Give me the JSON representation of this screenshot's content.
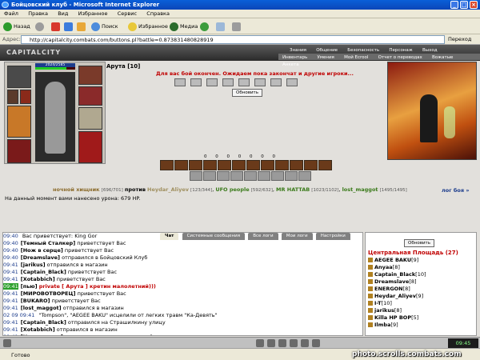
{
  "window": {
    "title": "Бойцовский клуб - Microsoft Internet Explorer"
  },
  "menu": [
    "Файл",
    "Правка",
    "Вид",
    "Избранное",
    "Сервис",
    "Справка"
  ],
  "toolbar": {
    "back": "Назад",
    "search": "Поиск",
    "favorites": "Избранное",
    "media": "Медиа"
  },
  "address": {
    "label": "Адрес:",
    "url": "http://capitalcity.combats.com/buttons.pl?battle=0.873831480828919",
    "go": "Переход"
  },
  "site": {
    "logo": "CAPITALCITY",
    "nav_top": [
      "Знания",
      "Общение",
      "Безопасность",
      "Персонаж",
      "Выход"
    ],
    "nav_sub": [
      "Инвентарь",
      "Умения",
      "Мой Ecrool",
      "Отчет о переводах",
      "Вожатые",
      "Анкета"
    ]
  },
  "character": {
    "name": "Арута [10]",
    "hp_text": "2024/2585",
    "hp_fraction": 0.78,
    "level_tag": "A 7627"
  },
  "battle": {
    "message": "Для вас бой окончен. Ожидаем пока закончат и другие игроки...",
    "refresh_label": "Обновить",
    "counts": [
      "0",
      "0",
      "0",
      "0",
      "0",
      "0",
      "0"
    ],
    "versus_word": "против",
    "owner_name": "ночной хищник",
    "owner_hp": "[696/701]",
    "opponents": [
      {
        "name": "Heydar_Aliyev",
        "hp": "[123/344]"
      },
      {
        "name": "UFO people",
        "hp": "[592/632]"
      },
      {
        "name": "MR HATTAB",
        "hp": "[1023/1102]"
      },
      {
        "name": "lost_maggot",
        "hp": "[1495/1495]"
      }
    ],
    "log_link": "лог боя »",
    "damage_text": "На данный момент вами нанесено урона: 679 HP."
  },
  "chat": {
    "tabs": [
      "Чат",
      "Системные сообщения",
      "Все логи",
      "Мои логи",
      "Настройки"
    ],
    "lines": [
      {
        "time": "09:40",
        "who": "",
        "text": "Вас приветствует: King Gor"
      },
      {
        "time": "09:40",
        "who": "[Темный Сталкер]",
        "text": "приветствует Вас"
      },
      {
        "time": "09:40",
        "who": "[Нож в серце]",
        "text": "приветствует Вас"
      },
      {
        "time": "09:40",
        "who": "[Dreamslave]",
        "text": "отправился в Бойцовский Клуб"
      },
      {
        "time": "09:41",
        "who": "[jarikus]",
        "text": "отправился в магазин"
      },
      {
        "time": "09:41",
        "who": "[Captain_Black]",
        "text": "приветствует Вас"
      },
      {
        "time": "09:41",
        "who": "[Xotabbich]",
        "text": "приветствует Вас"
      },
      {
        "time": "09:41",
        "who": "[пью]",
        "text": "private [ Арута ] кретин малолетний)))"
      },
      {
        "time": "09:41",
        "who": "[МИРОВОТВОРЕЦ]",
        "text": "приветствует Вас"
      },
      {
        "time": "09:41",
        "who": "[BUKARO]",
        "text": "приветствует Вас"
      },
      {
        "time": "09:41",
        "who": "[lost_maggot]",
        "text": "отправился в магазин"
      },
      {
        "time": "02 09 09:41",
        "who": "",
        "text": "\"Tompson\", \"AEGEE BAKU\" исцелили от легких травм \"Ка-Девять\""
      },
      {
        "time": "09:41",
        "who": "[Captain_Black]",
        "text": "отправился на Страшилкину улицу"
      },
      {
        "time": "09:41",
        "who": "[Xotabbich]",
        "text": "отправился в магазин"
      },
      {
        "time": "09:41",
        "who": "[Нож в серце]",
        "text": "отправился в парк развлечений"
      }
    ]
  },
  "square": {
    "refresh_label": "Обновить",
    "title": "Центральная Площадь (27)",
    "users": [
      {
        "name": "AEGEE BAKU",
        "level": "[9]"
      },
      {
        "name": "Anyaa",
        "level": "[8]"
      },
      {
        "name": "Captain_Black",
        "level": "[10]"
      },
      {
        "name": "Dreamslave",
        "level": "[8]"
      },
      {
        "name": "ENERGON",
        "level": "[8]"
      },
      {
        "name": "Heydar_Aliyev",
        "level": "[9]"
      },
      {
        "name": "I-T",
        "level": "[10]"
      },
      {
        "name": "jarikus",
        "level": "[8]"
      },
      {
        "name": "Killa HP BOP",
        "level": "[5]"
      },
      {
        "name": "Ilmba",
        "level": "[9]"
      }
    ]
  },
  "clock": "09:45",
  "status": "Готово",
  "watermark": "photo.scrolls.combats.com"
}
